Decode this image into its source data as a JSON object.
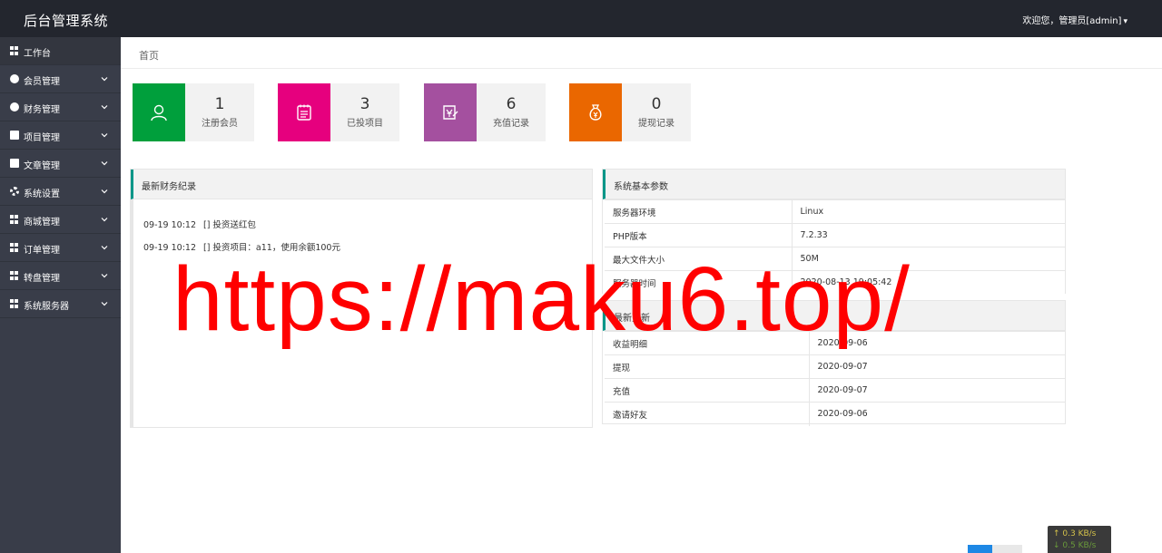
{
  "header": {
    "title": "后台管理系统",
    "user_text": "欢迎您，管理员[admin]"
  },
  "sidebar": {
    "items": [
      {
        "label": "工作台",
        "icon": "dashboard-icon",
        "has_arrow": false
      },
      {
        "label": "会员管理",
        "icon": "user-badge-icon",
        "has_arrow": true
      },
      {
        "label": "财务管理",
        "icon": "yen-icon",
        "has_arrow": true
      },
      {
        "label": "项目管理",
        "icon": "document-icon",
        "has_arrow": true
      },
      {
        "label": "文章管理",
        "icon": "article-icon",
        "has_arrow": true
      },
      {
        "label": "系统设置",
        "icon": "gear-icon",
        "has_arrow": true
      },
      {
        "label": "商城管理",
        "icon": "grid-icon",
        "has_arrow": true
      },
      {
        "label": "订单管理",
        "icon": "grid-icon",
        "has_arrow": true
      },
      {
        "label": "转盘管理",
        "icon": "grid-icon",
        "has_arrow": true
      },
      {
        "label": "系统服务器",
        "icon": "grid-icon",
        "has_arrow": true
      }
    ]
  },
  "breadcrumb": {
    "home": "首页"
  },
  "stats": [
    {
      "value": "1",
      "label": "注册会员",
      "color": "#009f3c",
      "icon": "user-icon"
    },
    {
      "value": "3",
      "label": "已投项目",
      "color": "#e6007e",
      "icon": "clipboard-icon"
    },
    {
      "value": "6",
      "label": "充值记录",
      "color": "#a4509f",
      "icon": "recharge-icon"
    },
    {
      "value": "0",
      "label": "提现记录",
      "color": "#ea6700",
      "icon": "money-bag-icon"
    }
  ],
  "finance_panel": {
    "title": "最新财务纪录",
    "records": [
      {
        "time": "09-19 10:12",
        "text": "[] 投资送红包"
      },
      {
        "time": "09-19 10:12",
        "text": "[] 投资项目：a11，使用余额100元"
      }
    ]
  },
  "system_panel": {
    "title": "系统基本参数",
    "rows": [
      {
        "key": "服务器环境",
        "value": "Linux"
      },
      {
        "key": "PHP版本",
        "value": "7.2.33"
      },
      {
        "key": "最大文件大小",
        "value": "50M"
      },
      {
        "key": "服务器时间",
        "value": "2020-08-13 19:05:42"
      }
    ]
  },
  "update_panel": {
    "title": "最新更新",
    "rows": [
      {
        "key": "收益明细",
        "value": "2020-09-06"
      },
      {
        "key": "提现",
        "value": "2020-09-07"
      },
      {
        "key": "充值",
        "value": "2020-09-07"
      },
      {
        "key": "邀请好友",
        "value": "2020-09-06"
      }
    ]
  },
  "watermark": "https://maku6.top/",
  "net_speed": {
    "up": "↑ 0.3 KB/s",
    "down": "↓ 0.5 KB/s"
  }
}
